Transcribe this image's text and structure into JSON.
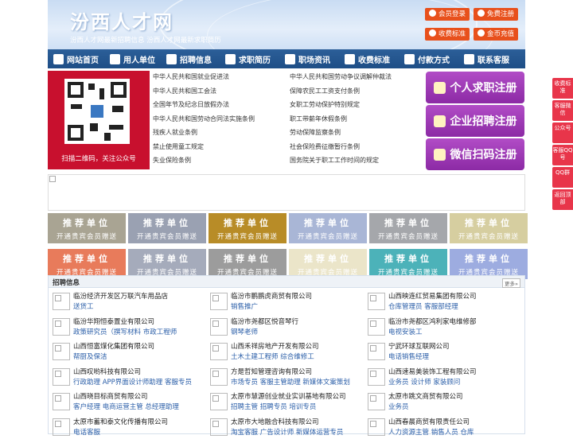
{
  "header": {
    "site_title": "汾西人才网",
    "subtitle": "汾西人才网最新招聘信息   汾西人才网最新求职简历",
    "buttons": [
      "会员登录",
      "免费注册",
      "收费标准",
      "金币充值"
    ]
  },
  "nav": [
    {
      "label": "网站首页",
      "icon": "home-icon"
    },
    {
      "label": "用人单位",
      "icon": "building-icon"
    },
    {
      "label": "招聘信息",
      "icon": "broadcast-icon"
    },
    {
      "label": "求职简历",
      "icon": "resume-icon"
    },
    {
      "label": "职场资讯",
      "icon": "news-icon"
    },
    {
      "label": "收费标准",
      "icon": "yen-icon"
    },
    {
      "label": "付款方式",
      "icon": "card-icon"
    },
    {
      "label": "联系客服",
      "icon": "phone-icon"
    }
  ],
  "qr": {
    "caption": "扫描二维码，关注公众号"
  },
  "laws": [
    [
      "中华人民共和国就业促进法",
      "中华人民共和国劳动争议调解仲裁法"
    ],
    [
      "中华人民共和国工会法",
      "保障农民工工资支付条例"
    ],
    [
      "全国年节及纪念日放假办法",
      "女职工劳动保护特别规定"
    ],
    [
      "中华人民共和国劳动合同法实施条例",
      "职工带薪年休假条例"
    ],
    [
      "残疾人就业条例",
      "劳动保障监察条例"
    ],
    [
      "禁止使用童工规定",
      "社会保险费征缴暂行条例"
    ],
    [
      "失业保险条例",
      "国务院关于职工工作时间的规定"
    ]
  ],
  "register": [
    {
      "label": "个人求职注册",
      "icon": "person-icon"
    },
    {
      "label": "企业招聘注册",
      "icon": "company-icon"
    },
    {
      "label": "微信扫码注册",
      "icon": "wechat-icon"
    }
  ],
  "ads": {
    "line1": "推荐单位",
    "line2": "开通贵宾会员赠送",
    "colors": [
      "#a9a493",
      "#9aa1b2",
      "#b88c27",
      "#a9b6d6",
      "#a5a7ab",
      "#d6cea0",
      "#e87b5b",
      "#a5abbb",
      "#9c9c9c",
      "#ebe5c9",
      "#4cb2b9",
      "#9dace0"
    ]
  },
  "jobs": {
    "title": "招聘信息",
    "more": "更多»",
    "items": [
      {
        "company": "临汾经济开发区万联汽车用品店",
        "positions": "送货工"
      },
      {
        "company": "临汾市鹏鹏虎商贸有限公司",
        "positions": "销售推广"
      },
      {
        "company": "山西映连红贸易集团有限公司",
        "positions": "仓库管理员  客服部经理"
      },
      {
        "company": "临汾华翔恒泰置业有限公司",
        "positions": "政策研究员（撰写材料  市政工程师"
      },
      {
        "company": "临汾市尧都区悦音琴行",
        "positions": "钢琴老师"
      },
      {
        "company": "临汾市尧都区鸿利家电维修部",
        "positions": "电视安装工"
      },
      {
        "company": "山西恒富煤化集团有限公司",
        "positions": "帮厨及保洁"
      },
      {
        "company": "山西禾祥房地产开发有限公司",
        "positions": "土木土建工程师  综合维修工"
      },
      {
        "company": "宁武环球互联网公司",
        "positions": "电话销售经理"
      },
      {
        "company": "山西叹哟科技有限公司",
        "positions": "行政助理  APP界面设计师助理  客服专员"
      },
      {
        "company": "方是哲知管理咨询有限公司",
        "positions": "市场专员  客服主管助理  新媒体文案策划"
      },
      {
        "company": "山西速易美装饰工程有限公司",
        "positions": "业务员  设计师  家装顾问"
      },
      {
        "company": "山西晓目标商贸有限公司",
        "positions": "客户经理  电商运营主管  总经理助理"
      },
      {
        "company": "太原市慧源创业就业实训基地有限公司",
        "positions": "招聘主管  招聘专员  培训专员"
      },
      {
        "company": "太原市跳文商贸有限公司",
        "positions": "业务员"
      },
      {
        "company": "太原市蓄和泰文化传播有限公司",
        "positions": "电话客服"
      },
      {
        "company": "太原市大地融合科技有限公司",
        "positions": "淘宝客服  广告设计师  新媒体运营专员"
      },
      {
        "company": "山西春晨商贸有限责任公司",
        "positions": "人力资源主管  销售人员  仓库"
      }
    ]
  },
  "side": [
    "收费标准",
    "客服微信",
    "公众号",
    "客服QQ号",
    "QQ群",
    "返回顶部"
  ]
}
